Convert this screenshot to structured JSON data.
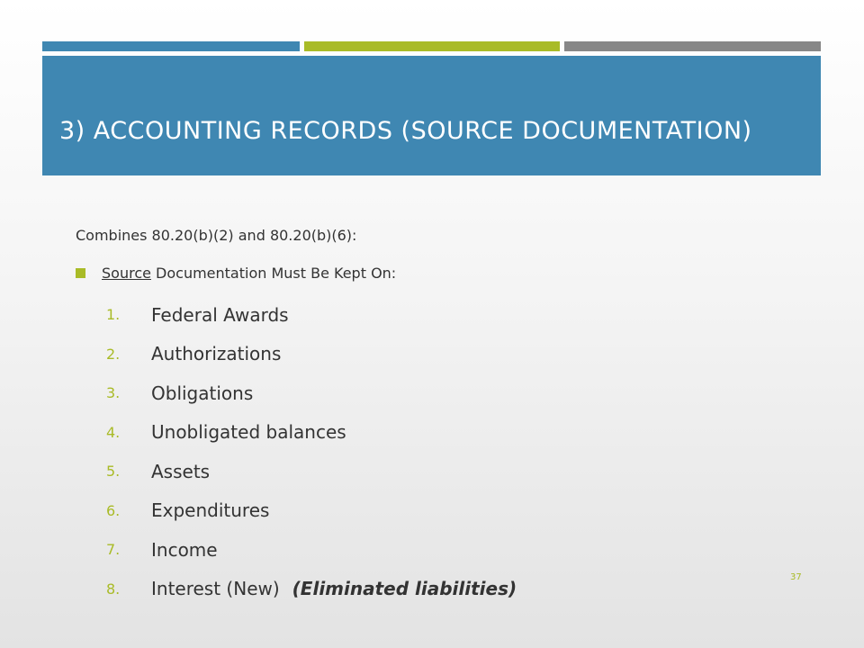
{
  "slide": {
    "title": "3) ACCOUNTING RECORDS  (SOURCE DOCUMENTATION)",
    "subhead": "Combines 80.20(b)(2) and 80.20(b)(6):",
    "bullet": {
      "underlined_word": "Source",
      "rest": " Documentation Must Be Kept On:"
    },
    "items": [
      {
        "num": "1.",
        "text": "Federal Awards",
        "emphasis": ""
      },
      {
        "num": "2.",
        "text": "Authorizations",
        "emphasis": ""
      },
      {
        "num": "3.",
        "text": "Obligations",
        "emphasis": ""
      },
      {
        "num": "4.",
        "text": "Unobligated balances",
        "emphasis": ""
      },
      {
        "num": "5.",
        "text": "Assets",
        "emphasis": ""
      },
      {
        "num": "6.",
        "text": "Expenditures",
        "emphasis": ""
      },
      {
        "num": "7.",
        "text": "Income",
        "emphasis": ""
      },
      {
        "num": "8.",
        "text": "Interest (New)",
        "emphasis": "(Eliminated liabilities)"
      }
    ],
    "page_number": "37"
  },
  "colors": {
    "blue": "#3f87b2",
    "green": "#a9bb27",
    "gray": "#878787"
  }
}
